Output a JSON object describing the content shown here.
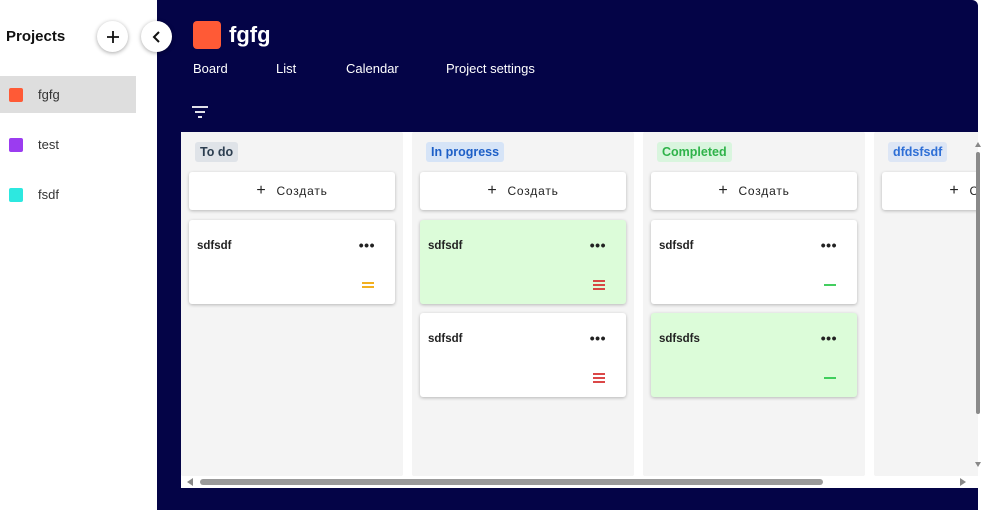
{
  "sidebar": {
    "title": "Projects",
    "add_icon": "plus-icon",
    "collapse_icon": "chevron-left-icon",
    "projects": [
      {
        "label": "fgfg",
        "color": "#ff5a36",
        "active": true
      },
      {
        "label": "test",
        "color": "#9b3cf0",
        "active": false
      },
      {
        "label": "fsdf",
        "color": "#2de8e0",
        "active": false
      }
    ]
  },
  "header": {
    "project_name": "fgfg",
    "project_color": "#ff5a36",
    "tabs": [
      "Board",
      "List",
      "Calendar",
      "Project settings"
    ],
    "filter_icon": "filter-icon"
  },
  "board": {
    "create_label": "Создать",
    "columns": [
      {
        "title": "To do",
        "title_color": "#2c3e50",
        "title_bg": "#dfe3e8",
        "cards": [
          {
            "title": "sdfsdf",
            "priority": "medium",
            "priority_color": "#f0a500",
            "highlight": false
          }
        ]
      },
      {
        "title": "In progress",
        "title_color": "#1d5fc7",
        "title_bg": "#d6e4f7",
        "cards": [
          {
            "title": "sdfsdf",
            "priority": "high",
            "priority_color": "#d62e2e",
            "highlight": true
          },
          {
            "title": "sdfsdf",
            "priority": "high",
            "priority_color": "#d62e2e",
            "highlight": false
          }
        ]
      },
      {
        "title": "Completed",
        "title_color": "#2fb34a",
        "title_bg": "#d9f5de",
        "cards": [
          {
            "title": "sdfsdf",
            "priority": "low",
            "priority_color": "#2fc84e",
            "highlight": false
          },
          {
            "title": "sdfsdfs",
            "priority": "low",
            "priority_color": "#2fc84e",
            "highlight": true
          }
        ]
      },
      {
        "title": "dfdsfsdf",
        "title_color": "#2e6fd6",
        "title_bg": "#dde6f5",
        "cards": []
      }
    ]
  },
  "colors": {
    "main_bg": "#040447",
    "card_highlight": "#dcfcd9"
  }
}
